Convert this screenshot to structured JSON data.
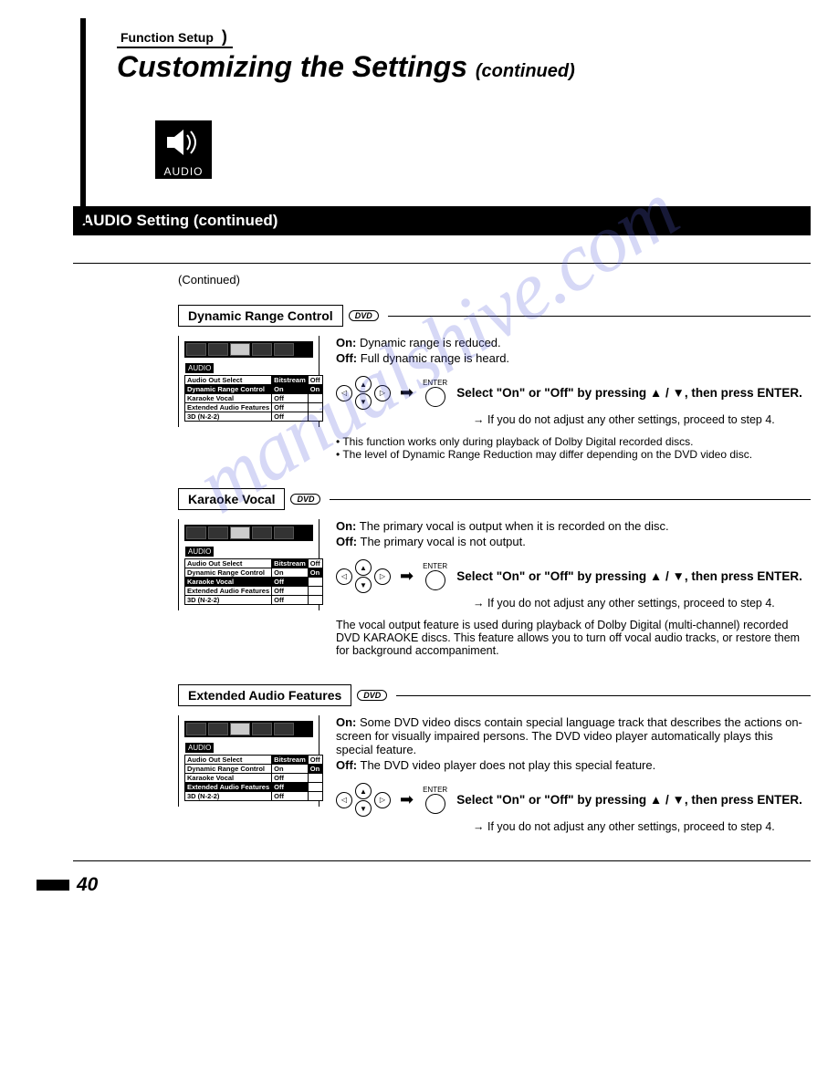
{
  "header": {
    "breadcrumb": "Function Setup",
    "title_main": "Customizing the Settings",
    "title_cont": "(continued)",
    "audio_icon_label": "AUDIO"
  },
  "section_bar": "AUDIO Setting (continued)",
  "continued_label": "(Continued)",
  "dvd_badge": "DVD",
  "enter_label": "ENTER",
  "instruction_common": "Select \"On\" or \"Off\" by pressing ▲ / ▼, then press ENTER.",
  "proceed_common": "→ If you do not adjust any other settings, proceed to step 4.",
  "menu": {
    "category": "AUDIO",
    "rows": [
      {
        "label": "Audio Out Select",
        "val1": "Bitstream",
        "val2": "Off"
      },
      {
        "label": "Dynamic Range Control",
        "val1": "On",
        "val2": "On"
      },
      {
        "label": "Karaoke Vocal",
        "val1": "Off",
        "val2": ""
      },
      {
        "label": "Extended Audio Features",
        "val1": "Off",
        "val2": ""
      },
      {
        "label": "3D (N-2-2)",
        "val1": "Off",
        "val2": ""
      }
    ]
  },
  "settings": {
    "drc": {
      "title": "Dynamic Range Control",
      "on": "Dynamic range is reduced.",
      "off": "Full dynamic range is heard.",
      "bullets": [
        "This function works only during playback of Dolby Digital recorded discs.",
        "The level of Dynamic Range Reduction may differ depending on the DVD video disc."
      ],
      "highlight_row": 1
    },
    "karaoke": {
      "title": "Karaoke Vocal",
      "on": "The primary vocal is output when it is recorded on the disc.",
      "off": "The primary vocal is not output.",
      "note": "The vocal output feature is used during playback of Dolby Digital (multi-channel) recorded DVD KARAOKE discs. This feature allows you to turn off vocal audio tracks, or restore them for background accompaniment.",
      "highlight_row": 2
    },
    "ext": {
      "title": "Extended Audio Features",
      "on": "Some DVD video discs contain special language track that describes the actions on-screen for visually impaired persons. The DVD video player automatically plays this special feature.",
      "off": "The DVD video player does not play this special feature.",
      "highlight_row": 3
    }
  },
  "page_number": "40",
  "watermark": "manualshive.com"
}
